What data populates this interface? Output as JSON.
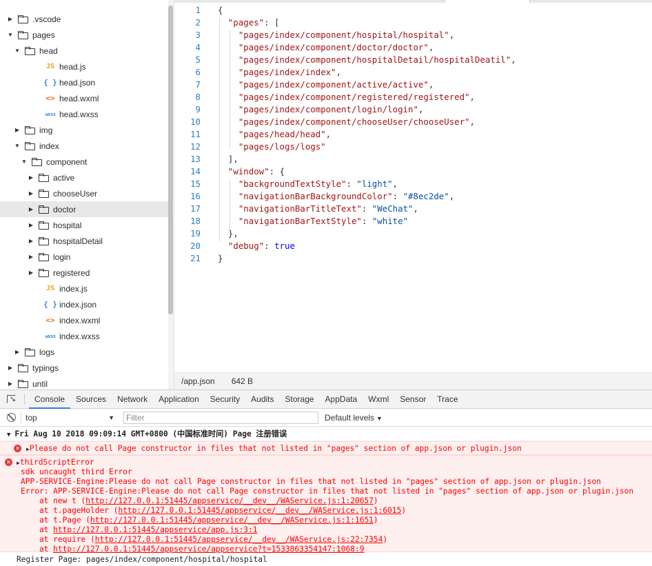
{
  "tree": {
    "items": [
      {
        "label": ".vscode",
        "type": "folder",
        "expanded": false,
        "depth": 0
      },
      {
        "label": "pages",
        "type": "folder",
        "expanded": true,
        "depth": 0
      },
      {
        "label": "head",
        "type": "folder",
        "expanded": true,
        "depth": 1
      },
      {
        "label": "head.js",
        "type": "js",
        "depth": 2
      },
      {
        "label": "head.json",
        "type": "json",
        "depth": 2
      },
      {
        "label": "head.wxml",
        "type": "wxml",
        "depth": 2
      },
      {
        "label": "head.wxss",
        "type": "wxss",
        "depth": 2
      },
      {
        "label": "img",
        "type": "folder",
        "expanded": false,
        "depth": 1
      },
      {
        "label": "index",
        "type": "folder",
        "expanded": true,
        "depth": 1
      },
      {
        "label": "component",
        "type": "folder",
        "expanded": true,
        "depth": 2
      },
      {
        "label": "active",
        "type": "folder",
        "expanded": false,
        "depth": 3
      },
      {
        "label": "chooseUser",
        "type": "folder",
        "expanded": false,
        "depth": 3
      },
      {
        "label": "doctor",
        "type": "folder",
        "expanded": false,
        "depth": 3,
        "selected": true
      },
      {
        "label": "hospital",
        "type": "folder",
        "expanded": false,
        "depth": 3
      },
      {
        "label": "hospitalDetail",
        "type": "folder",
        "expanded": false,
        "depth": 3
      },
      {
        "label": "login",
        "type": "folder",
        "expanded": false,
        "depth": 3
      },
      {
        "label": "registered",
        "type": "folder",
        "expanded": false,
        "depth": 3
      },
      {
        "label": "index.js",
        "type": "js",
        "depth": 2
      },
      {
        "label": "index.json",
        "type": "json",
        "depth": 2
      },
      {
        "label": "index.wxml",
        "type": "wxml",
        "depth": 2
      },
      {
        "label": "index.wxss",
        "type": "wxss",
        "depth": 2
      },
      {
        "label": "logs",
        "type": "folder",
        "expanded": false,
        "depth": 1
      },
      {
        "label": "typings",
        "type": "folder",
        "expanded": false,
        "depth": 0
      },
      {
        "label": "until",
        "type": "folder",
        "expanded": false,
        "depth": 0
      }
    ],
    "icons": {
      "js": "JS",
      "json": "{ }",
      "wxml": "<>",
      "wxss": "wxss"
    }
  },
  "editor": {
    "lines": [
      [
        [
          "p",
          "{"
        ]
      ],
      [
        [
          "p",
          "  "
        ],
        [
          "k",
          "\"pages\""
        ],
        [
          "p",
          ": ["
        ]
      ],
      [
        [
          "p",
          "    "
        ],
        [
          "s",
          "\"pages/index/component/hospital/hospital\""
        ],
        [
          "p",
          ","
        ]
      ],
      [
        [
          "p",
          "    "
        ],
        [
          "s",
          "\"pages/index/component/doctor/doctor\""
        ],
        [
          "p",
          ","
        ]
      ],
      [
        [
          "p",
          "    "
        ],
        [
          "s",
          "\"pages/index/component/hospitalDetail/hospitalDeatil\""
        ],
        [
          "p",
          ","
        ]
      ],
      [
        [
          "p",
          "    "
        ],
        [
          "s",
          "\"pages/index/index\""
        ],
        [
          "p",
          ","
        ]
      ],
      [
        [
          "p",
          "    "
        ],
        [
          "s",
          "\"pages/index/component/active/active\""
        ],
        [
          "p",
          ","
        ]
      ],
      [
        [
          "p",
          "    "
        ],
        [
          "s",
          "\"pages/index/component/registered/registered\""
        ],
        [
          "p",
          ","
        ]
      ],
      [
        [
          "p",
          "    "
        ],
        [
          "s",
          "\"pages/index/component/login/login\""
        ],
        [
          "p",
          ","
        ]
      ],
      [
        [
          "p",
          "    "
        ],
        [
          "s",
          "\"pages/index/component/chooseUser/chooseUser\""
        ],
        [
          "p",
          ","
        ]
      ],
      [
        [
          "p",
          "    "
        ],
        [
          "s",
          "\"pages/head/head\""
        ],
        [
          "p",
          ","
        ]
      ],
      [
        [
          "p",
          "    "
        ],
        [
          "s",
          "\"pages/logs/logs\""
        ]
      ],
      [
        [
          "p",
          "  ],"
        ]
      ],
      [
        [
          "p",
          "  "
        ],
        [
          "k",
          "\"window\""
        ],
        [
          "p",
          ": {"
        ]
      ],
      [
        [
          "p",
          "    "
        ],
        [
          "k",
          "\"backgroundTextStyle\""
        ],
        [
          "p",
          ": "
        ],
        [
          "v",
          "\"light\""
        ],
        [
          "p",
          ","
        ]
      ],
      [
        [
          "p",
          "    "
        ],
        [
          "k",
          "\"navigationBarBackgroundColor\""
        ],
        [
          "p",
          ": "
        ],
        [
          "v",
          "\"#8ec2de\""
        ],
        [
          "p",
          ","
        ]
      ],
      [
        [
          "p",
          "    "
        ],
        [
          "k",
          "\"navigationBarTitleText\""
        ],
        [
          "p",
          ": "
        ],
        [
          "v",
          "\"WeChat\""
        ],
        [
          "p",
          ","
        ]
      ],
      [
        [
          "p",
          "    "
        ],
        [
          "k",
          "\"navigationBarTextStyle\""
        ],
        [
          "p",
          ": "
        ],
        [
          "v",
          "\"white\""
        ]
      ],
      [
        [
          "p",
          "  },"
        ]
      ],
      [
        [
          "p",
          "  "
        ],
        [
          "k",
          "\"debug\""
        ],
        [
          "p",
          ": "
        ],
        [
          "w",
          "true"
        ]
      ],
      [
        [
          "p",
          "}"
        ]
      ]
    ]
  },
  "status": {
    "path": "/app.json",
    "size": "642 B"
  },
  "devtools": {
    "tabs": [
      "Console",
      "Sources",
      "Network",
      "Application",
      "Security",
      "Audits",
      "Storage",
      "AppData",
      "Wxml",
      "Sensor",
      "Trace"
    ],
    "active_tab": "Console",
    "context": "top",
    "filter_placeholder": "Filter",
    "levels": "Default levels",
    "group_header": "Fri Aug 10 2018 09:09:14 GMT+0800 (中国标准时间) Page 注册错误",
    "error1": "Please do not call Page constructor in files that not listed in \"pages\" section of app.json or plugin.json",
    "error2_title": "thirdScriptError",
    "error2_lines": [
      "sdk uncaught third Error",
      "APP-SERVICE-Engine:Please do not call Page constructor in files that not listed in \"pages\" section of app.json or plugin.json",
      "Error: APP-SERVICE-Engine:Please do not call Page constructor in files that not listed in \"pages\" section of app.json or plugin.json"
    ],
    "stack": [
      {
        "prefix": "    at new t (",
        "link": "http://127.0.0.1:51445/appservice/__dev__/WAService.js:1:20657",
        "suffix": ")"
      },
      {
        "prefix": "    at t.pageHolder (",
        "link": "http://127.0.0.1:51445/appservice/__dev__/WAService.js:1:6015",
        "suffix": ")"
      },
      {
        "prefix": "    at t.Page (",
        "link": "http://127.0.0.1:51445/appservice/__dev__/WAService.js:1:1651",
        "suffix": ")"
      },
      {
        "prefix": "    at ",
        "link": "http://127.0.0.1:51445/appservice/app.js:3:1",
        "suffix": ""
      },
      {
        "prefix": "    at require (",
        "link": "http://127.0.0.1:51445/appservice/__dev__/WAService.js:22:7354",
        "suffix": ")"
      },
      {
        "prefix": "    at ",
        "link": "http://127.0.0.1:51445/appservice/appservice?t=1533863354147:1068:9",
        "suffix": ""
      }
    ],
    "log": "Register Page: pages/index/component/hospital/hospital"
  }
}
